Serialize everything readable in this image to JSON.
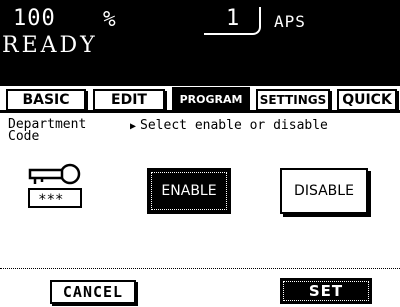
{
  "status": {
    "copies": "100",
    "zoom_unit": "%",
    "count": "1",
    "paper_mode": "APS",
    "state": "READY"
  },
  "tabs": [
    {
      "label": "BASIC",
      "active": false
    },
    {
      "label": "EDIT",
      "active": false
    },
    {
      "label": "PROGRAM",
      "active": true
    },
    {
      "label": "SETTINGS",
      "active": false
    },
    {
      "label": "QUICK",
      "active": false
    }
  ],
  "screen": {
    "section_label": "Department Code",
    "instruction": "Select enable or disable",
    "key_mask": "***_"
  },
  "buttons": {
    "enable": "ENABLE",
    "disable": "DISABLE",
    "cancel": "CANCEL",
    "set": "SET"
  },
  "selected_option": "enable"
}
